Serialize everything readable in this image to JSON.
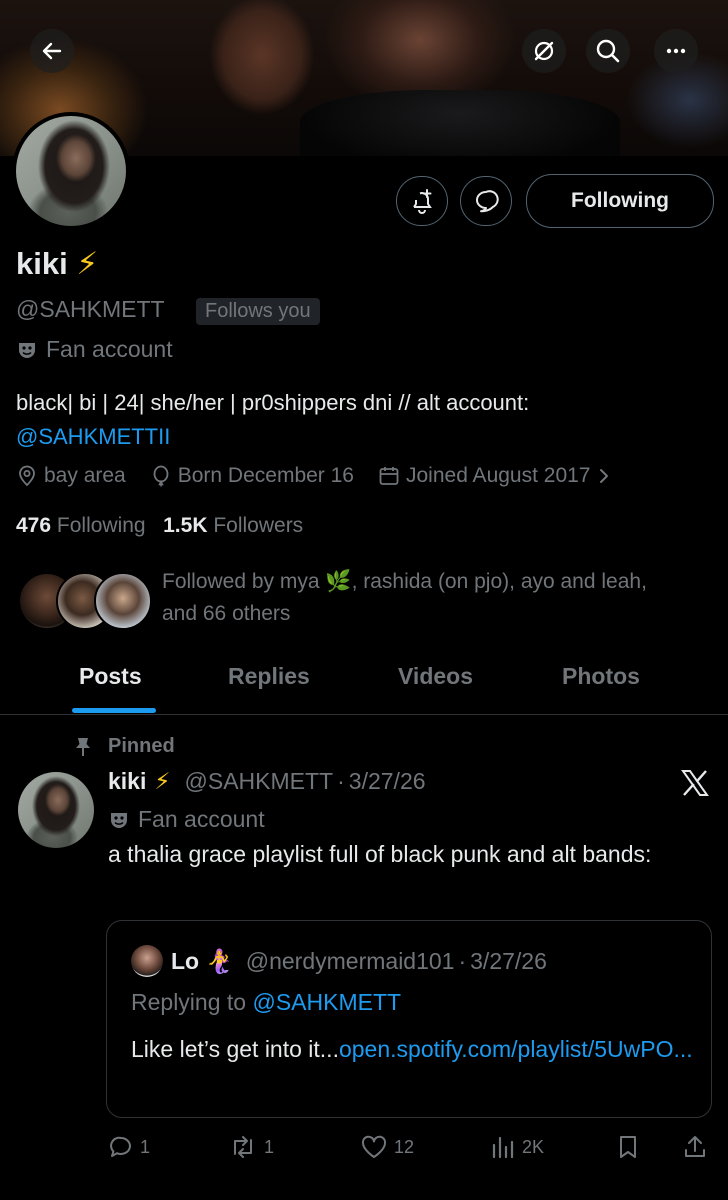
{
  "header": {
    "back_icon": "arrow-left-icon",
    "actions": [
      "grok-icon",
      "search-icon",
      "more-icon"
    ]
  },
  "profile": {
    "display_name": "kiki",
    "emoji": "⚡",
    "handle": "@SAHKMETT",
    "follows_you": "Follows you",
    "account_label": "Fan account",
    "bio_text": "black| bi | 24| she/her | pr0shippers dni // alt account:",
    "bio_link": "@SAHKMETTII",
    "location": "bay area",
    "birthday": "Born December 16",
    "joined": "Joined August 2017",
    "following_count": "476",
    "following_label": "Following",
    "followers_count": "1.5K",
    "followers_label": "Followers",
    "followed_by_prefix": "Followed by mya",
    "followed_by_emoji": "🌿",
    "followed_by_rest": ", rashida (on pjo), ayo and leah,",
    "followed_by_line2": "and 66 others"
  },
  "buttons": {
    "following": "Following"
  },
  "tabs": [
    "Posts",
    "Replies",
    "Videos",
    "Photos"
  ],
  "post": {
    "pinned_label": "Pinned",
    "name": "kiki",
    "emoji": "⚡",
    "handle": "@SAHKMETT",
    "dot": "·",
    "date": "3/27/26",
    "account_label": "Fan account",
    "text": "a thalia grace playlist full of black punk and alt bands:",
    "quote": {
      "name": "Lo",
      "emoji": "🧜‍♀️",
      "handle": "@nerdymermaid101",
      "dot": "·",
      "date": "3/27/26",
      "replying_prefix": "Replying to",
      "replying_handle": "@SAHKMETT",
      "text": "Like let’s get into it...",
      "link": "open.spotify.com/playlist/5UwPO..."
    },
    "stats": {
      "replies": "1",
      "reposts": "1",
      "likes": "12",
      "views": "2K"
    }
  },
  "colors": {
    "background": "#000000",
    "text": "#e7e9ea",
    "muted": "#71767b",
    "accent": "#1d9bf0",
    "border": "#2f3336"
  }
}
